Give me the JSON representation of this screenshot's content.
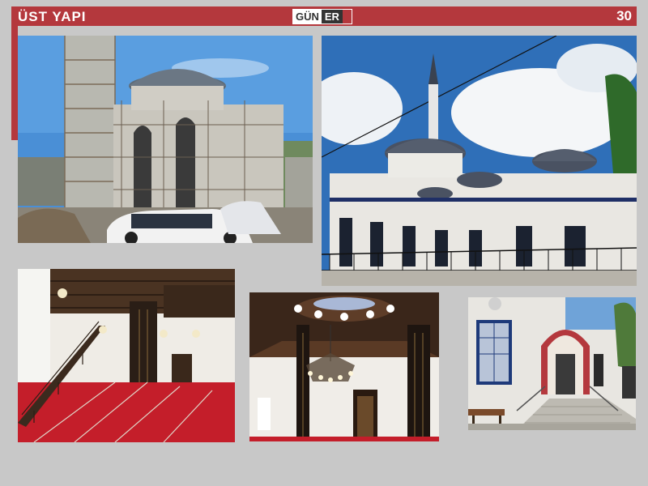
{
  "header": {
    "title": "ÜST YAPI",
    "page_number": "30",
    "logo_part1": "GÜN",
    "logo_part2": "ER"
  },
  "photos": [
    {
      "id": "mosque-under-construction"
    },
    {
      "id": "mosque-exterior-completed"
    },
    {
      "id": "prayer-hall-interior"
    },
    {
      "id": "dome-interior-chandelier"
    },
    {
      "id": "side-entrance"
    }
  ],
  "colors": {
    "accent": "#b4383d",
    "background": "#c8c8c8"
  }
}
